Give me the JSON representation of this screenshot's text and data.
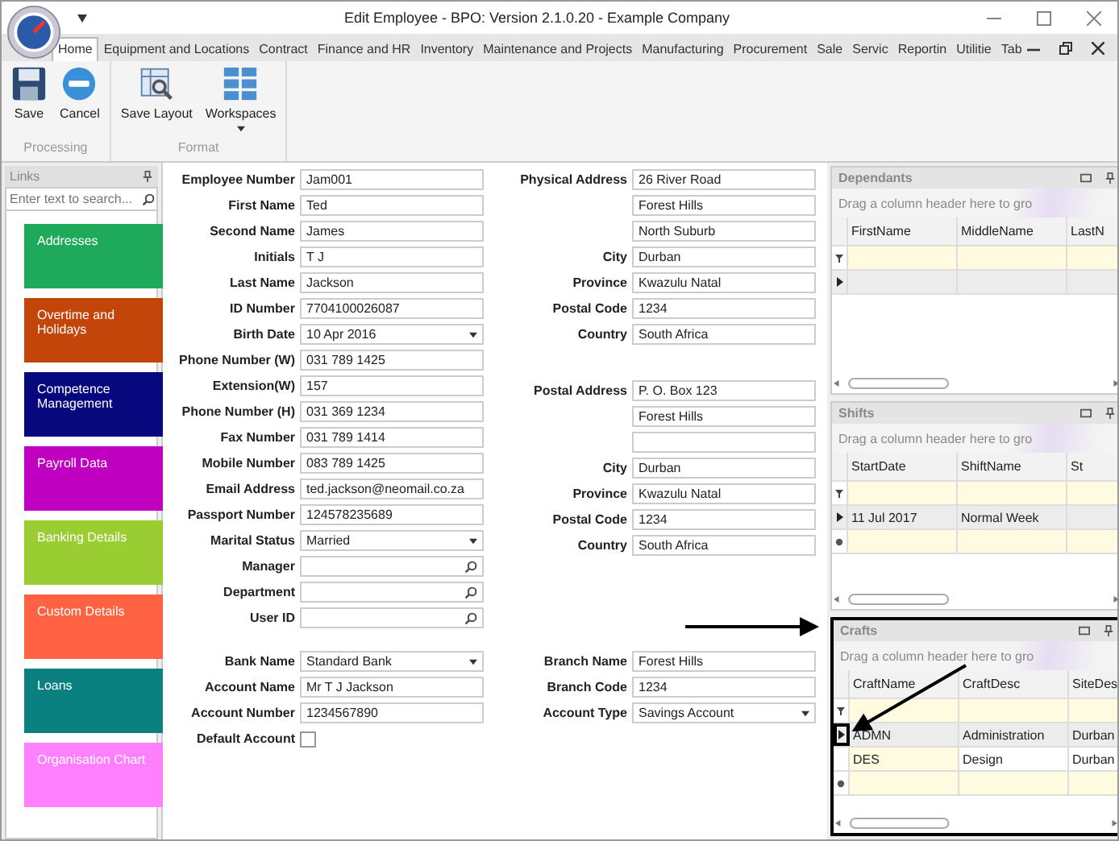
{
  "window": {
    "title": "Edit Employee - BPO: Version 2.1.0.20 - Example Company"
  },
  "tabs": [
    {
      "label": "Home",
      "selected": true
    },
    {
      "label": "Equipment and Locations",
      "selected": false
    },
    {
      "label": "Contract",
      "selected": false
    },
    {
      "label": "Finance and HR",
      "selected": false
    },
    {
      "label": "Inventory",
      "selected": false
    },
    {
      "label": "Maintenance and Projects",
      "selected": false
    },
    {
      "label": "Manufacturing",
      "selected": false
    },
    {
      "label": "Procurement",
      "selected": false
    },
    {
      "label": "Sale",
      "selected": false
    },
    {
      "label": "Servic",
      "selected": false
    },
    {
      "label": "Reportin",
      "selected": false
    },
    {
      "label": "Utilitie",
      "selected": false
    },
    {
      "label": "Tab",
      "selected": false
    }
  ],
  "ribbon_groups": [
    {
      "label": "Processing",
      "buttons": [
        {
          "label": "Save",
          "dropdown": false
        },
        {
          "label": "Cancel",
          "dropdown": false
        }
      ]
    },
    {
      "label": "Format",
      "buttons": [
        {
          "label": "Save Layout",
          "dropdown": false
        },
        {
          "label": "Workspaces",
          "dropdown": true
        }
      ]
    }
  ],
  "links": {
    "title": "Links",
    "search": {
      "placeholder": "Enter text to search..."
    },
    "items": [
      {
        "label": "Addresses",
        "color": "#1fa95a"
      },
      {
        "label": "Overtime and Holidays",
        "color": "#c4450a"
      },
      {
        "label": "Competence Management",
        "color": "#08087e"
      },
      {
        "label": "Payroll Data",
        "color": "#c000c0"
      },
      {
        "label": "Banking Details",
        "color": "#9acd32"
      },
      {
        "label": "Custom Details",
        "color": "#ff6242"
      },
      {
        "label": "Loans",
        "color": "#0b8080"
      },
      {
        "label": "Organisation Chart",
        "color": "#ff80ff"
      }
    ]
  },
  "form": {
    "personal": [
      {
        "label": "Employee Number",
        "kind": "text",
        "value": "Jam001"
      },
      {
        "label": "First Name",
        "kind": "text",
        "value": "Ted"
      },
      {
        "label": "Second Name",
        "kind": "text",
        "value": "James"
      },
      {
        "label": "Initials",
        "kind": "text",
        "value": "T J"
      },
      {
        "label": "Last Name",
        "kind": "text",
        "value": "Jackson"
      },
      {
        "label": "ID Number",
        "kind": "text",
        "value": "7704100026087"
      },
      {
        "label": "Birth Date",
        "kind": "dropdown",
        "value": "10 Apr 2016"
      },
      {
        "label": "Phone Number (W)",
        "kind": "text",
        "value": "031 789 1425"
      },
      {
        "label": "Extension(W)",
        "kind": "text",
        "value": "157"
      },
      {
        "label": "Phone Number (H)",
        "kind": "text",
        "value": "031 369 1234"
      },
      {
        "label": "Fax Number",
        "kind": "text",
        "value": "031 789 1414"
      },
      {
        "label": "Mobile Number",
        "kind": "text",
        "value": "083 789 1425"
      },
      {
        "label": "Email Address",
        "kind": "text",
        "value": "ted.jackson@neomail.co.za"
      },
      {
        "label": "Passport Number",
        "kind": "text",
        "value": "124578235689"
      },
      {
        "label": "Marital Status",
        "kind": "dropdown",
        "value": "Married"
      },
      {
        "label": "Manager",
        "kind": "lookup"
      },
      {
        "label": "Department",
        "kind": "lookup"
      },
      {
        "label": "User ID",
        "kind": "lookup"
      }
    ],
    "physical_address": [
      {
        "label": "Physical Address",
        "kind": "text",
        "value": "26 River Road"
      },
      {
        "kind": "text",
        "value": "Forest Hills"
      },
      {
        "kind": "text",
        "value": "North Suburb"
      },
      {
        "label": "City",
        "kind": "text",
        "value": "Durban"
      },
      {
        "label": "Province",
        "kind": "text",
        "value": "Kwazulu Natal"
      },
      {
        "label": "Postal Code",
        "kind": "text",
        "value": "1234"
      },
      {
        "label": "Country",
        "kind": "text",
        "value": "South Africa"
      }
    ],
    "postal_address": [
      {
        "label": "Postal Address",
        "kind": "text",
        "value": "P. O. Box 123"
      },
      {
        "kind": "text",
        "value": "Forest Hills"
      },
      {
        "kind": "text"
      },
      {
        "label": "City",
        "kind": "text",
        "value": "Durban"
      },
      {
        "label": "Province",
        "kind": "text",
        "value": "Kwazulu Natal"
      },
      {
        "label": "Postal Code",
        "kind": "text",
        "value": "1234"
      },
      {
        "label": "Country",
        "kind": "text",
        "value": "South Africa"
      }
    ],
    "bank_left": [
      {
        "label": "Bank Name",
        "kind": "dropdown",
        "value": "Standard Bank"
      },
      {
        "label": "Account Name",
        "kind": "text",
        "value": "Mr T J Jackson"
      },
      {
        "label": "Account Number",
        "kind": "text",
        "value": "1234567890"
      },
      {
        "label": "Default Account",
        "kind": "checkbox",
        "checked": false
      }
    ],
    "bank_right": [
      {
        "label": "Branch Name",
        "kind": "text",
        "value": "Forest Hills"
      },
      {
        "label": "Branch Code",
        "kind": "text",
        "value": "1234"
      },
      {
        "label": "Account Type",
        "kind": "dropdown",
        "value": "Savings Account"
      }
    ]
  },
  "panels": [
    {
      "title": "Dependants",
      "group_hint": "Drag a column header here to gro",
      "columns": [
        "FirstName",
        "MiddleName",
        "LastN"
      ],
      "highlighted": false,
      "new_row": false,
      "rows": [
        {
          "selected": true,
          "highlighted": false
        }
      ]
    },
    {
      "title": "Shifts",
      "group_hint": "Drag a column header here to gro",
      "columns": [
        "StartDate",
        "ShiftName",
        "St"
      ],
      "highlighted": false,
      "new_row": true,
      "rows": [
        {
          "selected": true,
          "highlighted": false,
          "cells": [
            "11 Jul 2017",
            "Normal Week"
          ]
        }
      ]
    },
    {
      "title": "Crafts",
      "group_hint": "Drag a column header here to gro",
      "columns": [
        "CraftName",
        "CraftDesc",
        "SiteDes"
      ],
      "highlighted": true,
      "new_row": true,
      "rows": [
        {
          "selected": true,
          "highlighted": true,
          "cells": [
            "ADMN",
            "Administration",
            "Durban"
          ]
        },
        {
          "selected": false,
          "highlighted": false,
          "cells": [
            "DES",
            "Design",
            "Durban"
          ]
        }
      ]
    }
  ]
}
